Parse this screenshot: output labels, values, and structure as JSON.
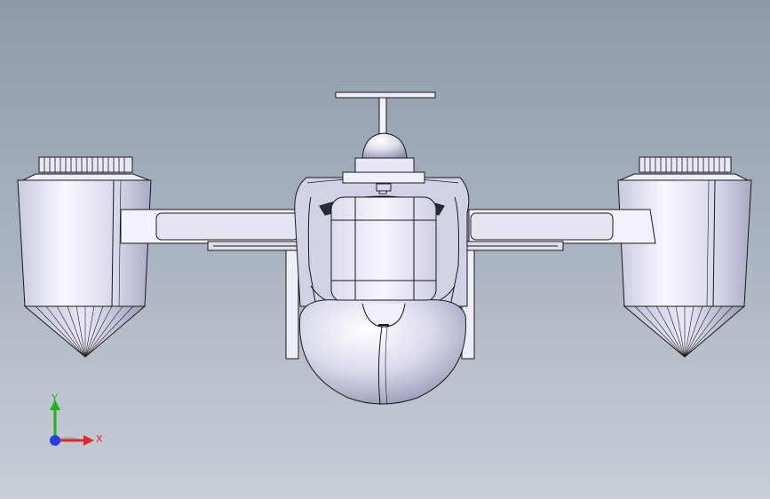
{
  "triad": {
    "x_label": "X",
    "y_label": "Y",
    "colors": {
      "x": "#e0282a",
      "y": "#20b020",
      "z": "#2a3ce0"
    }
  },
  "model": {
    "body_color": "#e4e4f4",
    "shade_color": "#b7b7cf",
    "edge_color": "#1a1a1a"
  }
}
